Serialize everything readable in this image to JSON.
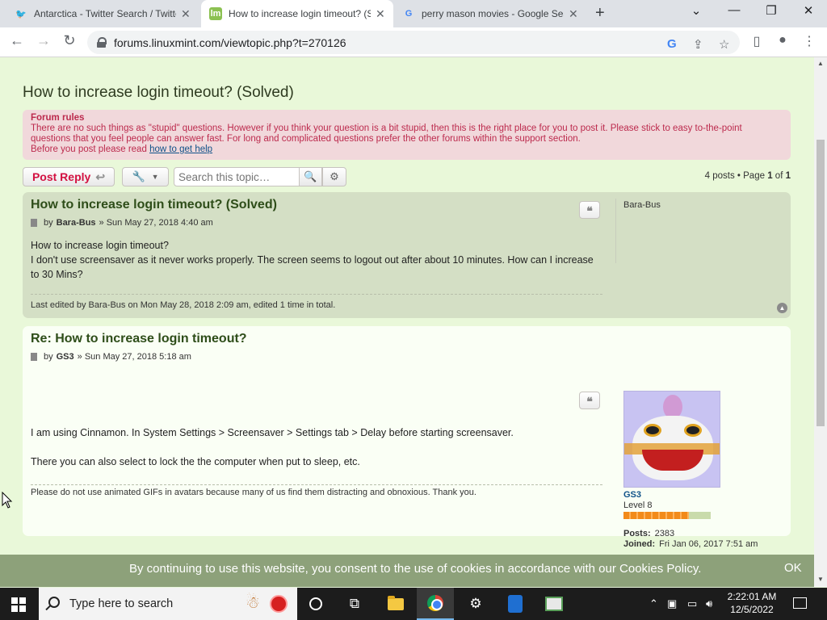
{
  "browser": {
    "tabs": [
      {
        "title": "Antarctica - Twitter Search / Twitter",
        "favicon": "twitter-icon"
      },
      {
        "title": "How to increase login timeout? (Solved)",
        "favicon": "linux-mint-icon"
      },
      {
        "title": "perry mason movies - Google Search",
        "favicon": "google-icon"
      }
    ],
    "url": "forums.linuxmint.com/viewtopic.php?t=270126"
  },
  "topic": {
    "title": "How to increase login timeout? (Solved)"
  },
  "forum_rules": {
    "title": "Forum rules",
    "text": "There are no such things as \"stupid\" questions. However if you think your question is a bit stupid, then this is the right place for you to post it. Please stick to easy to-the-point questions that you feel people can answer fast. For long and complicated questions prefer the other forums within the support section.",
    "help_prefix": "Before you post please read",
    "help_link": "how to get help"
  },
  "actions": {
    "post_reply": "Post Reply",
    "search_placeholder": "Search this topic…",
    "posts_count": "4 posts",
    "page_label": "Page",
    "page_current": "1",
    "page_of": "of",
    "page_total": "1"
  },
  "posts": [
    {
      "title": "How to increase login timeout? (Solved)",
      "by": "by",
      "author": "Bara-Bus",
      "date": "» Sun May 27, 2018 4:40 am",
      "content": [
        "How to increase login timeout?",
        "I don't use screensaver as it never works properly. The screen seems to logout out after about 10 minutes. How can I increase to 30 Mins?"
      ],
      "footnote": "Last edited by Bara-Bus on Mon May 28, 2018 2:09 am, edited 1 time in total.",
      "profile_name": "Bara-Bus"
    },
    {
      "title": "Re: How to increase login timeout?",
      "by": "by",
      "author": "GS3",
      "date": "» Sun May 27, 2018 5:18 am",
      "content": [
        "I am using Cinnamon. In System Settings > Screensaver > Settings tab > Delay before starting screensaver.",
        "There you can also select to lock the the computer when put to sleep, etc."
      ],
      "footnote": "Please do not use animated GIFs in avatars because many of us find them distracting and obnoxious. Thank you.",
      "profile_name": "GS3",
      "rank": "Level 8",
      "rank_progress": 0.75,
      "posts_label": "Posts:",
      "posts_value": "2383",
      "joined_label": "Joined:",
      "joined_value": "Fri Jan 06, 2017 7:51 am"
    }
  ],
  "cookie": {
    "text": "By continuing to use this website, you consent to the use of cookies in accordance with our Cookies Policy.",
    "ok": "OK"
  },
  "taskbar": {
    "search_placeholder": "Type here to search",
    "time": "2:22:01 AM",
    "date": "12/5/2022"
  },
  "colors": {
    "page_bg": "#e9f8d9",
    "rules_bg": "#f1d8db",
    "rules_text": "#bc2a4d",
    "reply_red": "#d31141",
    "post1_bg": "#d4dfc5",
    "post2_bg": "#fafff5",
    "cookie_bg": "#8da17a"
  }
}
